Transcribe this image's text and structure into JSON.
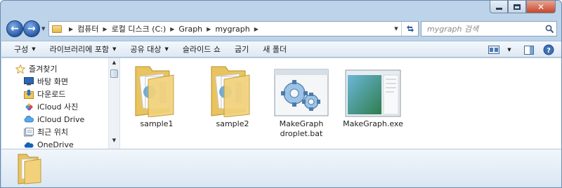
{
  "window": {
    "colors": {
      "accent": "#2859a8",
      "chrome": "#bcd3ea",
      "close": "#c7462a"
    }
  },
  "address": {
    "crumbs": [
      "컴퓨터",
      "로컬 디스크 (C:)",
      "Graph",
      "mygraph"
    ]
  },
  "search": {
    "placeholder": "mygraph 검색"
  },
  "commands": [
    {
      "label": "구성",
      "dropdown": true
    },
    {
      "label": "라이브러리에 포함",
      "dropdown": true
    },
    {
      "label": "공유 대상",
      "dropdown": true
    },
    {
      "label": "슬라이드 쇼",
      "dropdown": false
    },
    {
      "label": "굽기",
      "dropdown": false
    },
    {
      "label": "새 폴더",
      "dropdown": false
    }
  ],
  "navpane": {
    "items": [
      {
        "label": "즐겨찾기",
        "icon": "star-icon"
      },
      {
        "label": "바탕 화면",
        "icon": "desktop-icon"
      },
      {
        "label": "다운로드",
        "icon": "downloads-icon"
      },
      {
        "label": "iCloud 사진",
        "icon": "icloud-photos-icon"
      },
      {
        "label": "iCloud Drive",
        "icon": "icloud-drive-icon"
      },
      {
        "label": "최근 위치",
        "icon": "recent-places-icon"
      },
      {
        "label": "OneDrive",
        "icon": "onedrive-icon"
      }
    ]
  },
  "files": [
    {
      "name": "sample1",
      "type": "folder"
    },
    {
      "name": "sample2",
      "type": "folder"
    },
    {
      "name_line1": "MakeGraph",
      "name_line2": "droplet.bat",
      "type": "batch"
    },
    {
      "name": "MakeGraph.exe",
      "type": "exe"
    }
  ]
}
